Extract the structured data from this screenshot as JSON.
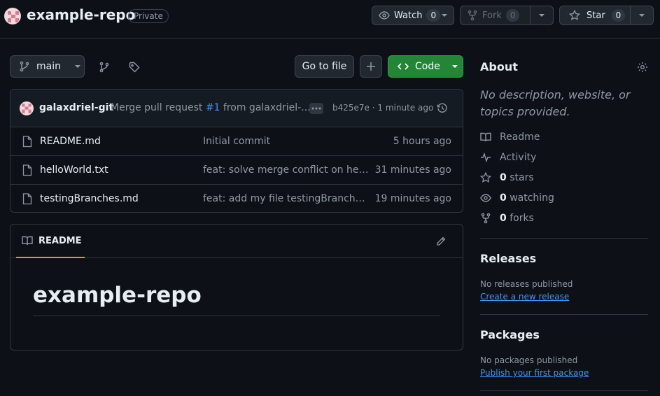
{
  "colors": {
    "background": "#0d1117",
    "border": "#30363d",
    "text": "#e6edf3",
    "muted": "#9198a1",
    "link": "#4493f8",
    "accent_green": "#238636",
    "tab_underline": "#f78166"
  },
  "repo": {
    "name": "example-repo",
    "visibility": "Private"
  },
  "header_actions": {
    "watch": {
      "label": "Watch",
      "count": "0",
      "icon": "eye-icon"
    },
    "fork": {
      "label": "Fork",
      "count": "0",
      "icon": "repo-forked-icon"
    },
    "star": {
      "label": "Star",
      "count": "0",
      "icon": "star-icon"
    }
  },
  "toolbar": {
    "branch": "main",
    "goto_file": "Go to file",
    "add_icon": "plus-icon",
    "code_label": "Code"
  },
  "latest_commit": {
    "author": "galaxdriel-git",
    "message_prefix": "Merge pull request ",
    "pr_link": "#1",
    "message_suffix": " from galaxdriel-...",
    "hash": "b425e7e",
    "separator": "·",
    "time": "1 minute ago"
  },
  "files": [
    {
      "name": "README.md",
      "message": "Initial commit",
      "time": "5 hours ago"
    },
    {
      "name": "helloWorld.txt",
      "message": "feat: solve merge conflict on hello...",
      "time": "31 minutes ago"
    },
    {
      "name": "testingBranches.md",
      "message": "feat: add my file testingBranches....",
      "time": "19 minutes ago"
    }
  ],
  "readme": {
    "tab_label": "README",
    "heading": "example-repo"
  },
  "about": {
    "title": "About",
    "description": "No description, website, or topics provided.",
    "readme_label": "Readme",
    "activity_label": "Activity",
    "stars_count": "0",
    "stars_label": "stars",
    "watching_count": "0",
    "watching_label": "watching",
    "forks_count": "0",
    "forks_label": "forks"
  },
  "releases": {
    "title": "Releases",
    "empty_text": "No releases published",
    "link": "Create a new release"
  },
  "packages": {
    "title": "Packages",
    "empty_text": "No packages published",
    "link": "Publish your first package"
  }
}
